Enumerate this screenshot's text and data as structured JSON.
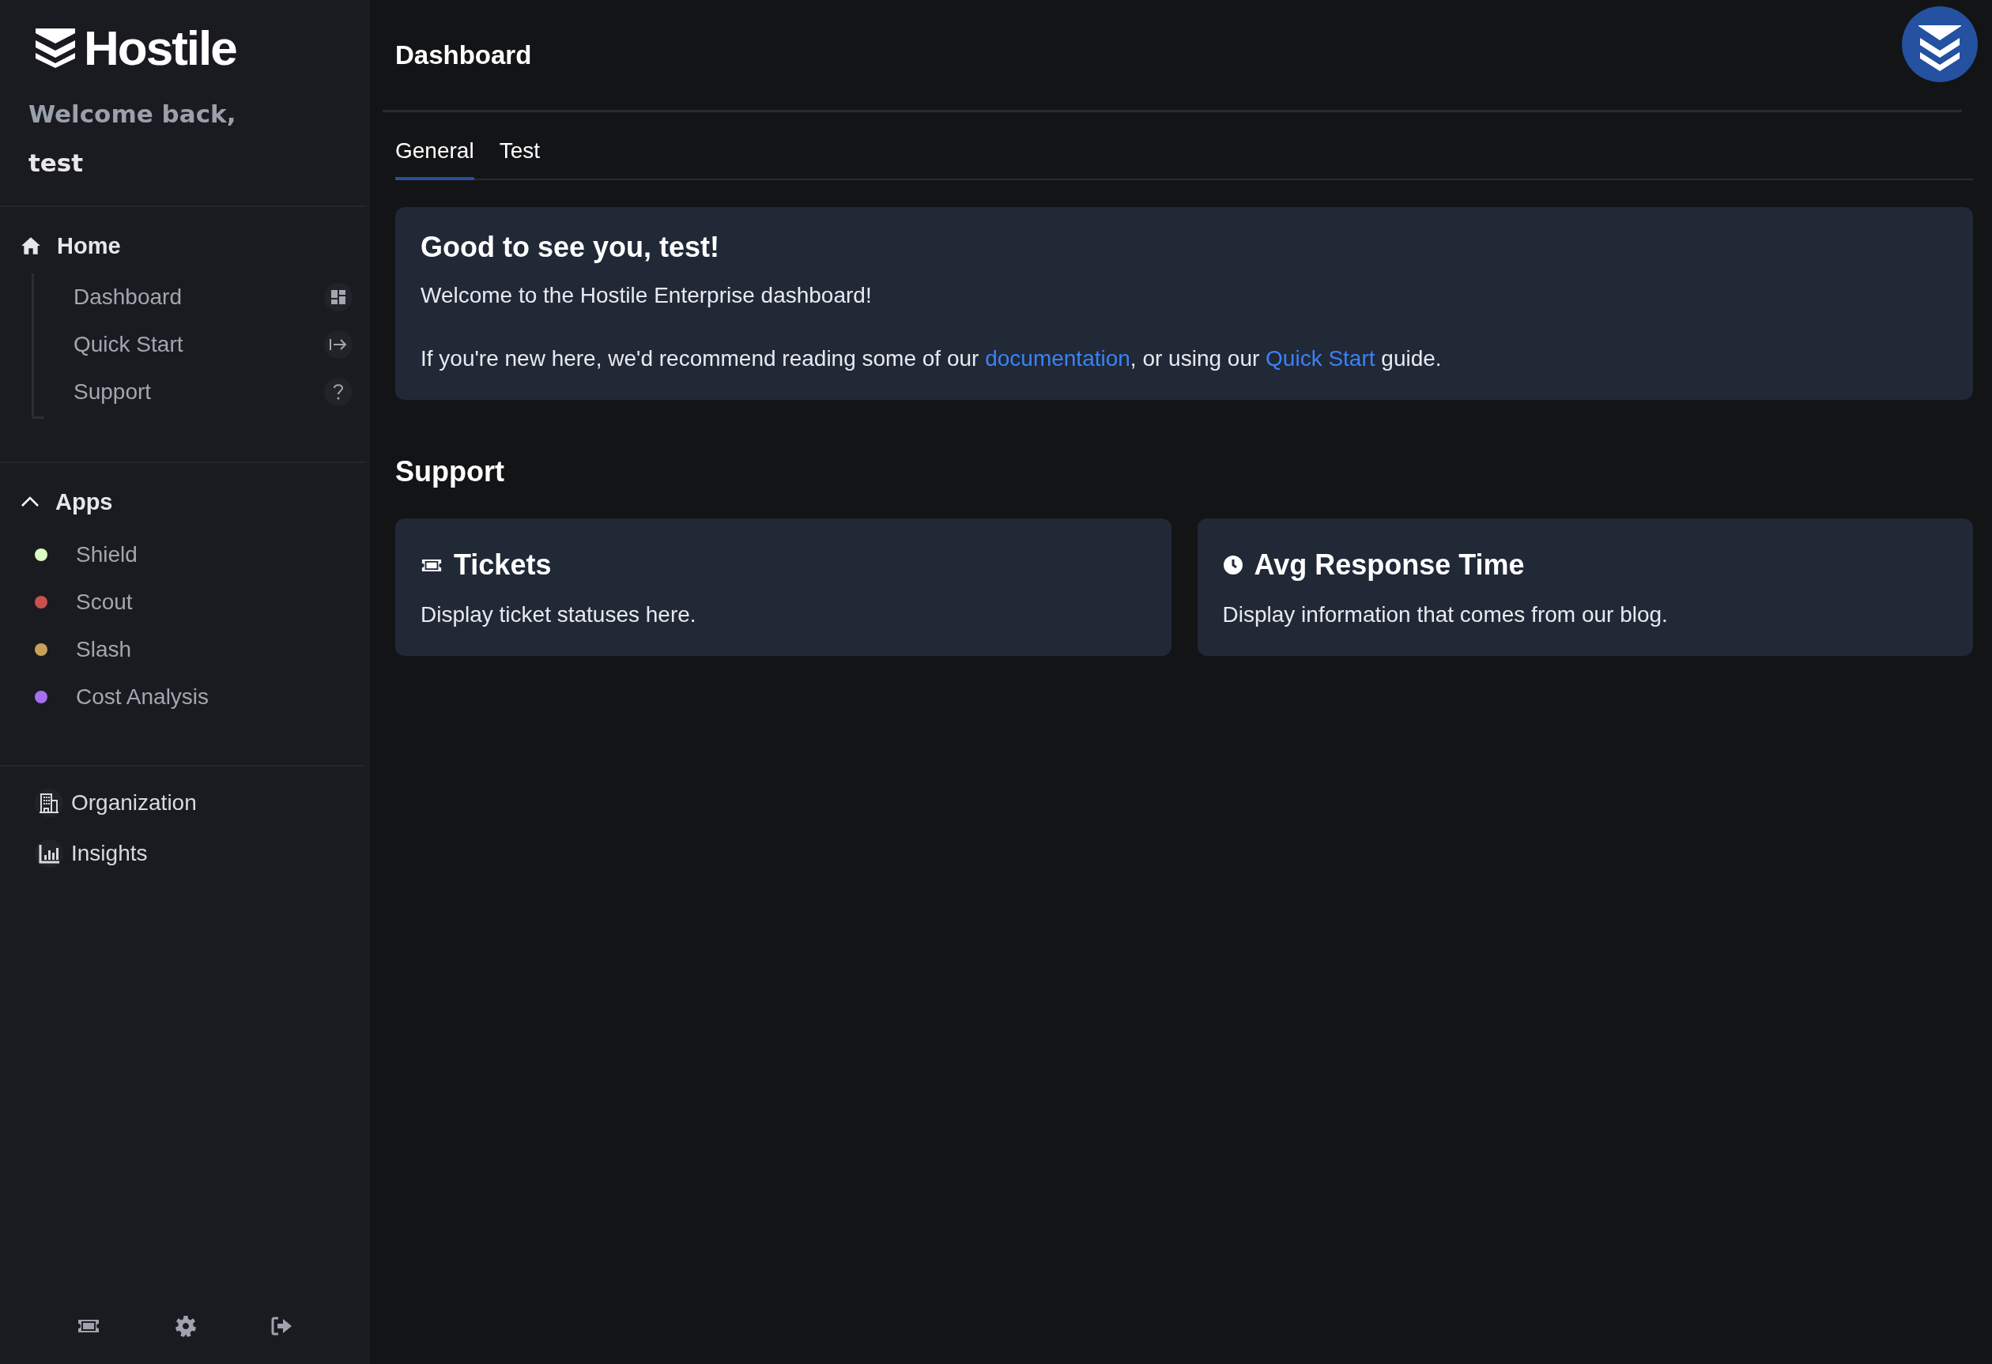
{
  "sidebar": {
    "logo_text": "Hostile",
    "welcome": "Welcome back,",
    "user": "test",
    "home": {
      "label": "Home",
      "items": [
        {
          "label": "Dashboard"
        },
        {
          "label": "Quick Start"
        },
        {
          "label": "Support"
        }
      ]
    },
    "apps": {
      "label": "Apps",
      "expanded": true,
      "items": [
        {
          "label": "Shield",
          "color": "#d9fcc4"
        },
        {
          "label": "Scout",
          "color": "#c9524d"
        },
        {
          "label": "Slash",
          "color": "#c9a05a"
        },
        {
          "label": "Cost Analysis",
          "color": "#a66ef0"
        }
      ]
    },
    "links": [
      {
        "label": "Organization"
      },
      {
        "label": "Insights"
      }
    ]
  },
  "header": {
    "title": "Dashboard"
  },
  "tabs": [
    {
      "label": "General",
      "selected": true
    },
    {
      "label": "Test",
      "selected": false
    }
  ],
  "welcome_card": {
    "title": "Good to see you, test!",
    "text": "Welcome to the Hostile Enterprise dashboard!",
    "intro": [
      {
        "kind": "text",
        "text": "If you're new here, we'd recommend reading some of our "
      },
      {
        "kind": "link",
        "text": "documentation"
      },
      {
        "kind": "text",
        "text": ", or using our "
      },
      {
        "kind": "link",
        "text": "Quick Start"
      },
      {
        "kind": "text",
        "text": " guide."
      }
    ]
  },
  "support": {
    "heading": "Support",
    "cards": [
      {
        "title": "Tickets",
        "text": "Display ticket statuses here."
      },
      {
        "title": "Avg Response Time",
        "text": "Display information that comes from our blog."
      }
    ]
  }
}
